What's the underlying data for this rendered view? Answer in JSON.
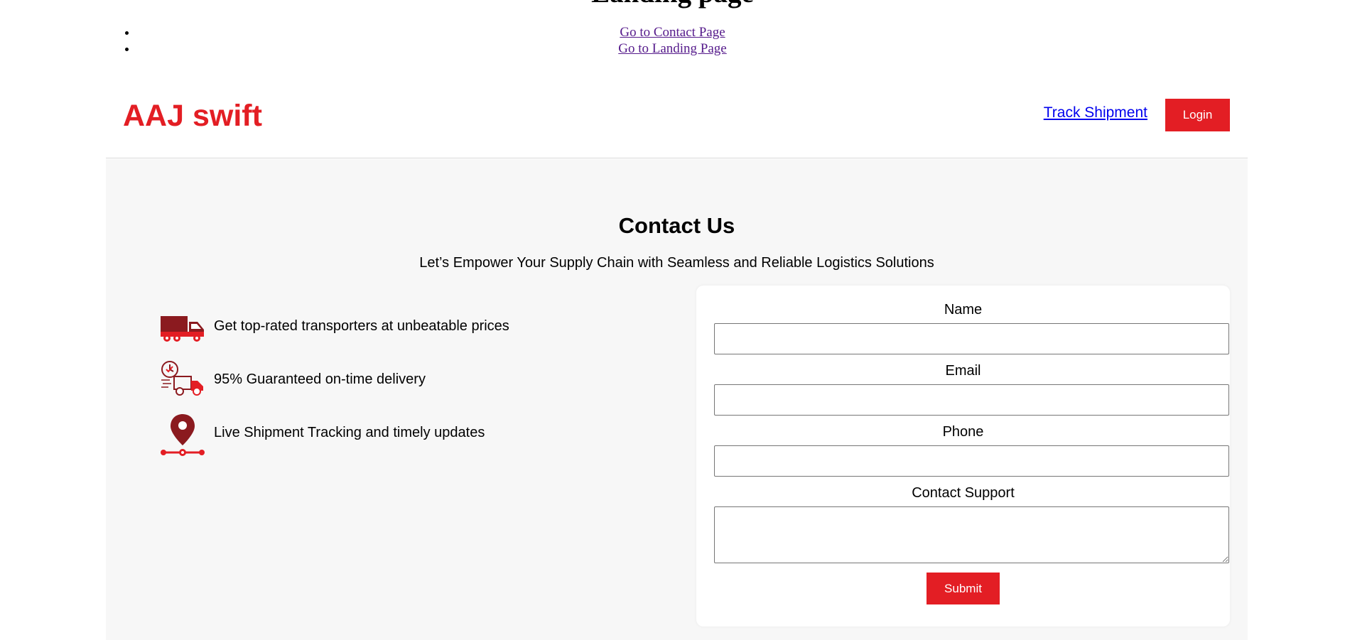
{
  "top": {
    "heading": "Landing page",
    "links": [
      {
        "label": "Go to Contact Page"
      },
      {
        "label": "Go to Landing Page"
      }
    ]
  },
  "navbar": {
    "brand": "AAJ swift",
    "track_label": "Track Shipment",
    "login_label": "Login"
  },
  "contact": {
    "title": "Contact Us",
    "subtitle": "Let’s Empower Your Supply Chain with Seamless and Reliable Logistics Solutions",
    "features": [
      {
        "icon": "truck-icon",
        "text": "Get top-rated transporters at unbeatable prices"
      },
      {
        "icon": "delivery-clock-icon",
        "text": "95% Guaranteed on-time delivery"
      },
      {
        "icon": "location-pin-icon",
        "text": "Live Shipment Tracking and timely updates"
      }
    ],
    "form": {
      "name_label": "Name",
      "name_value": "",
      "email_label": "Email",
      "email_value": "",
      "phone_label": "Phone",
      "phone_value": "",
      "support_label": "Contact Support",
      "support_value": "",
      "submit_label": "Submit"
    }
  },
  "colors": {
    "accent": "#e31e24",
    "icon_dark_red": "#8b1a1f",
    "section_bg": "#f7f7f7",
    "link": "#0000ee",
    "visited_link": "#551a8b"
  }
}
